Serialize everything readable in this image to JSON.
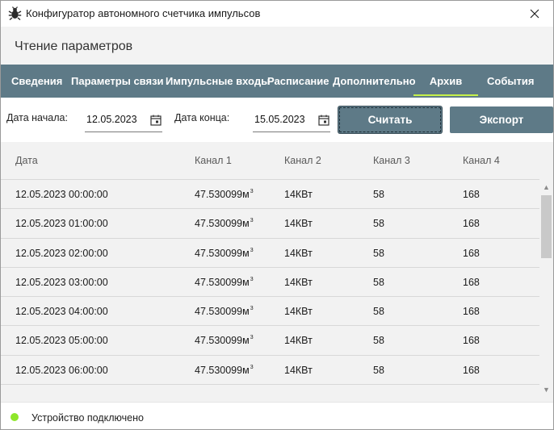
{
  "window": {
    "title": "Конфигуратор автономного счетчика импульсов"
  },
  "header": {
    "title": "Чтение параметров"
  },
  "tabs": [
    {
      "label": "Сведения",
      "active": false
    },
    {
      "label": "Параметры связи",
      "active": false
    },
    {
      "label": "Импульсные входы",
      "active": false
    },
    {
      "label": "Расписание",
      "active": false
    },
    {
      "label": "Дополнительно",
      "active": false
    },
    {
      "label": "Архив",
      "active": true
    },
    {
      "label": "События",
      "active": false
    }
  ],
  "filter": {
    "start_label": "Дата начала:",
    "start_value": "12.05.2023",
    "end_label": "Дата конца:",
    "end_value": "15.05.2023",
    "read_button": "Считать",
    "export_button": "Экспорт"
  },
  "table": {
    "columns": [
      "Дата",
      "Канал 1",
      "Канал 2",
      "Канал 3",
      "Канал 4"
    ],
    "unit_sup": "3",
    "rows": [
      {
        "date": "12.05.2023 00:00:00",
        "ch1": "47.530099м",
        "ch2": "14КВт",
        "ch3": "58",
        "ch4": "168"
      },
      {
        "date": "12.05.2023 01:00:00",
        "ch1": "47.530099м",
        "ch2": "14КВт",
        "ch3": "58",
        "ch4": "168"
      },
      {
        "date": "12.05.2023 02:00:00",
        "ch1": "47.530099м",
        "ch2": "14КВт",
        "ch3": "58",
        "ch4": "168"
      },
      {
        "date": "12.05.2023 03:00:00",
        "ch1": "47.530099м",
        "ch2": "14КВт",
        "ch3": "58",
        "ch4": "168"
      },
      {
        "date": "12.05.2023 04:00:00",
        "ch1": "47.530099м",
        "ch2": "14КВт",
        "ch3": "58",
        "ch4": "168"
      },
      {
        "date": "12.05.2023 05:00:00",
        "ch1": "47.530099м",
        "ch2": "14КВт",
        "ch3": "58",
        "ch4": "168"
      },
      {
        "date": "12.05.2023 06:00:00",
        "ch1": "47.530099м",
        "ch2": "14КВт",
        "ch3": "58",
        "ch4": "168"
      }
    ]
  },
  "status": {
    "text": "Устройство подключено",
    "indicator_color": "#8ee62a"
  },
  "colors": {
    "accent": "#5e7a87",
    "tab_underline": "#c6f04a"
  },
  "icons": {
    "app": "bug-icon",
    "close": "close-icon",
    "calendar": "calendar-icon",
    "scroll_up": "▲",
    "scroll_down": "▼"
  }
}
